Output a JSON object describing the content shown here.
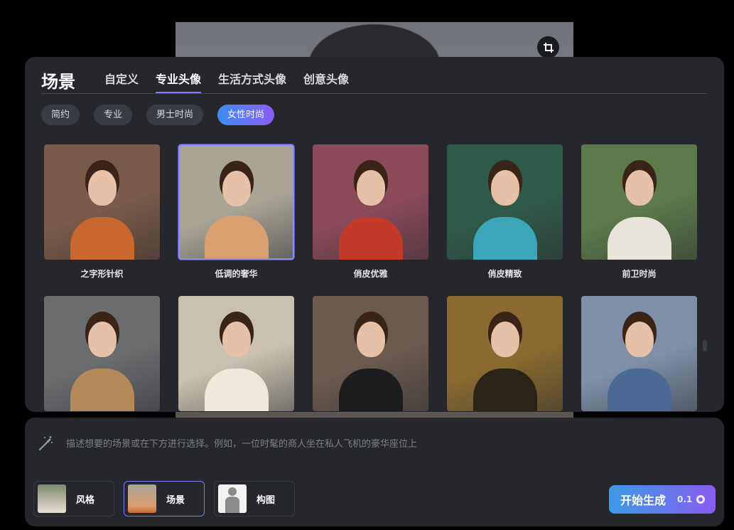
{
  "header": {
    "title": "场景",
    "tabs": [
      {
        "label": "自定义",
        "active": false
      },
      {
        "label": "专业头像",
        "active": true
      },
      {
        "label": "生活方式头像",
        "active": false
      },
      {
        "label": "创意头像",
        "active": false
      }
    ]
  },
  "filters": [
    {
      "label": "简约",
      "active": false
    },
    {
      "label": "专业",
      "active": false
    },
    {
      "label": "男士时尚",
      "active": false
    },
    {
      "label": "女性时尚",
      "active": true
    }
  ],
  "cards": [
    {
      "label": "之字形针织",
      "selected": false,
      "bg": "#7a5a48",
      "accent": "#c8682e"
    },
    {
      "label": "低调的奢华",
      "selected": true,
      "bg": "#a9a496",
      "accent": "#d9a070"
    },
    {
      "label": "俏皮优雅",
      "selected": false,
      "bg": "#8a4a5a",
      "accent": "#c43a2a"
    },
    {
      "label": "俏皮精致",
      "selected": false,
      "bg": "#2f5a4a",
      "accent": "#3aa6b8"
    },
    {
      "label": "前卫时尚",
      "selected": false,
      "bg": "#5c7a4a",
      "accent": "#e8e4dc"
    },
    {
      "label": "",
      "selected": false,
      "bg": "#6a6c6e",
      "accent": "#b58a5a"
    },
    {
      "label": "",
      "selected": false,
      "bg": "#c8c0b0",
      "accent": "#efe8dc"
    },
    {
      "label": "",
      "selected": false,
      "bg": "#6a5a50",
      "accent": "#1d1d1f"
    },
    {
      "label": "",
      "selected": false,
      "bg": "#8a6a30",
      "accent": "#2a2418"
    },
    {
      "label": "",
      "selected": false,
      "bg": "#7f90a8",
      "accent": "#4a6a94"
    }
  ],
  "prompt": {
    "placeholder": "描述想要的场景或在下方进行选择。例如，一位时髦的商人坐在私人飞机的豪华座位上"
  },
  "options": [
    {
      "label": "风格",
      "active": false
    },
    {
      "label": "场景",
      "active": true
    },
    {
      "label": "构图",
      "active": false
    }
  ],
  "generate": {
    "label": "开始生成",
    "cost": "0.1"
  },
  "icons": {
    "crop": "crop-icon",
    "wand": "magic-wand-icon",
    "coin": "credit-coin-icon"
  },
  "colors": {
    "accent": "#7e7cf5",
    "gradient_start": "#3a9be6",
    "gradient_end": "#8a5cf0"
  }
}
